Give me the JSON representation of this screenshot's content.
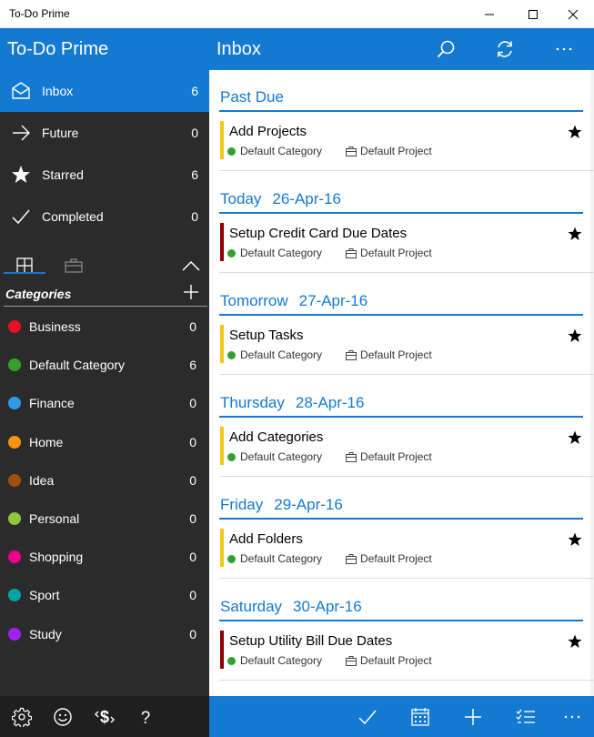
{
  "window": {
    "title": "To-Do Prime"
  },
  "header": {
    "app_name": "To-Do Prime",
    "view_title": "Inbox"
  },
  "nav": [
    {
      "label": "Inbox",
      "count": "6",
      "icon": "inbox-icon",
      "active": true
    },
    {
      "label": "Future",
      "count": "0",
      "icon": "arrow-right-icon",
      "active": false
    },
    {
      "label": "Starred",
      "count": "6",
      "icon": "star-icon",
      "active": false
    },
    {
      "label": "Completed",
      "count": "0",
      "icon": "checkmark-icon",
      "active": false
    }
  ],
  "categories_header": {
    "title": "Categories"
  },
  "categories": [
    {
      "label": "Business",
      "count": "0",
      "color": "#e81123"
    },
    {
      "label": "Default Category",
      "count": "6",
      "color": "#33a02c"
    },
    {
      "label": "Finance",
      "count": "0",
      "color": "#2d9be8"
    },
    {
      "label": "Home",
      "count": "0",
      "color": "#f7940f"
    },
    {
      "label": "Idea",
      "count": "0",
      "color": "#a0500e"
    },
    {
      "label": "Personal",
      "count": "0",
      "color": "#8dc63f"
    },
    {
      "label": "Shopping",
      "count": "0",
      "color": "#ec008c"
    },
    {
      "label": "Sport",
      "count": "0",
      "color": "#00a3a3"
    },
    {
      "label": "Study",
      "count": "0",
      "color": "#a020f0"
    }
  ],
  "sections": [
    {
      "day": "Past Due",
      "date": "",
      "task": {
        "title": "Add Projects",
        "category": "Default Category",
        "project": "Default Project",
        "priority_color": "#f5c518",
        "starred": true
      }
    },
    {
      "day": "Today",
      "date": "26-Apr-16",
      "task": {
        "title": "Setup Credit Card Due Dates",
        "category": "Default Category",
        "project": "Default Project",
        "priority_color": "#8b0000",
        "starred": true
      }
    },
    {
      "day": "Tomorrow",
      "date": "27-Apr-16",
      "task": {
        "title": "Setup Tasks",
        "category": "Default Category",
        "project": "Default Project",
        "priority_color": "#f5c518",
        "starred": true
      }
    },
    {
      "day": "Thursday",
      "date": "28-Apr-16",
      "task": {
        "title": "Add Categories",
        "category": "Default Category",
        "project": "Default Project",
        "priority_color": "#f5c518",
        "starred": true
      }
    },
    {
      "day": "Friday",
      "date": "29-Apr-16",
      "task": {
        "title": "Add Folders",
        "category": "Default Category",
        "project": "Default Project",
        "priority_color": "#f5c518",
        "starred": true
      }
    },
    {
      "day": "Saturday",
      "date": "30-Apr-16",
      "task": {
        "title": "Setup Utility Bill Due Dates",
        "category": "Default Category",
        "project": "Default Project",
        "priority_color": "#8b0000",
        "starred": true
      }
    }
  ],
  "colors": {
    "accent": "#1479d1",
    "sidebar": "#2b2b2b",
    "category_dot": "#33a02c"
  }
}
